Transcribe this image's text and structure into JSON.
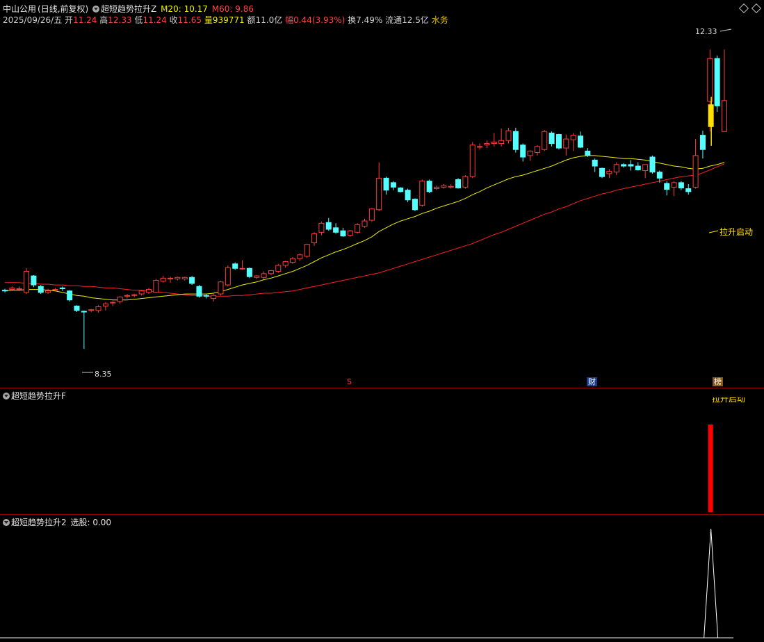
{
  "stock": {
    "name": "中山公用",
    "mode": "(日线,前复权)"
  },
  "main_indicator": {
    "name": "超短趋势拉升Z",
    "m20": "M20: 10.17",
    "m60": "M60: 9.86"
  },
  "info": {
    "date": "2025/09/26/五",
    "open_label": "开",
    "open": "11.24",
    "high_label": "高",
    "high": "12.33",
    "low_label": "低",
    "low": "11.24",
    "close_label": "收",
    "close": "11.65",
    "vol_label": "量",
    "vol": "939771",
    "amt_label": "额",
    "amt": "11.0亿",
    "chg_label": "幅",
    "chg": "0.44(3.93%)",
    "turn_label": "换",
    "turn": "7.49%",
    "float_label": "流通",
    "float": "12.5亿",
    "sector": "水务"
  },
  "annotations": {
    "max_price": "12.33",
    "min_price": "8.35",
    "signal": "拉升启动",
    "marker_s": "S",
    "marker_cai": "财",
    "marker_bang": "榜"
  },
  "sub1": {
    "name": "超短趋势拉升F",
    "label": "拉升启动"
  },
  "sub2": {
    "name": "超短趋势拉升2",
    "value": "选股: 0.00"
  },
  "colors": {
    "up": "#ff3c3c",
    "down": "#54ffff",
    "ma20": "#f0f000",
    "ma60": "#ff2020",
    "signal": "#ffe000"
  },
  "chart_data": {
    "type": "candlestick",
    "ylim": [
      8.0,
      12.6
    ],
    "candles": [
      [
        9.13,
        9.15,
        9.1,
        9.12
      ],
      [
        9.14,
        9.18,
        9.12,
        9.16
      ],
      [
        9.14,
        9.18,
        9.12,
        9.15
      ],
      [
        9.1,
        9.42,
        9.08,
        9.38
      ],
      [
        9.32,
        9.33,
        9.17,
        9.2
      ],
      [
        9.18,
        9.2,
        9.08,
        9.1
      ],
      [
        9.1,
        9.15,
        9.08,
        9.12
      ],
      [
        9.14,
        9.16,
        9.12,
        9.14
      ],
      [
        9.16,
        9.18,
        9.12,
        9.15
      ],
      [
        9.12,
        9.13,
        8.98,
        9.0
      ],
      [
        8.92,
        8.93,
        8.84,
        8.86
      ],
      [
        8.85,
        8.86,
        8.35,
        8.84
      ],
      [
        8.86,
        8.88,
        8.84,
        8.87
      ],
      [
        8.86,
        8.93,
        8.83,
        8.91
      ],
      [
        8.92,
        8.97,
        8.86,
        8.95
      ],
      [
        8.96,
        8.98,
        8.92,
        8.97
      ],
      [
        8.98,
        9.05,
        8.95,
        9.04
      ],
      [
        9.05,
        9.08,
        9.02,
        9.06
      ],
      [
        9.06,
        9.08,
        9.04,
        9.07
      ],
      [
        9.08,
        9.13,
        9.06,
        9.12
      ],
      [
        9.1,
        9.16,
        9.08,
        9.14
      ],
      [
        9.1,
        9.28,
        9.09,
        9.26
      ],
      [
        9.25,
        9.32,
        9.23,
        9.29
      ],
      [
        9.28,
        9.31,
        9.23,
        9.29
      ],
      [
        9.28,
        9.31,
        9.26,
        9.3
      ],
      [
        9.28,
        9.31,
        9.26,
        9.3
      ],
      [
        9.3,
        9.32,
        9.2,
        9.22
      ],
      [
        9.18,
        9.2,
        9.03,
        9.05
      ],
      [
        9.06,
        9.08,
        9.02,
        9.05
      ],
      [
        9.02,
        9.08,
        8.98,
        9.06
      ],
      [
        9.08,
        9.25,
        9.06,
        9.24
      ],
      [
        9.2,
        9.46,
        9.18,
        9.43
      ],
      [
        9.48,
        9.5,
        9.4,
        9.42
      ],
      [
        9.42,
        9.53,
        9.4,
        9.42
      ],
      [
        9.42,
        9.43,
        9.29,
        9.31
      ],
      [
        9.3,
        9.33,
        9.28,
        9.32
      ],
      [
        9.3,
        9.38,
        9.28,
        9.35
      ],
      [
        9.35,
        9.4,
        9.33,
        9.39
      ],
      [
        9.38,
        9.48,
        9.36,
        9.46
      ],
      [
        9.46,
        9.52,
        9.43,
        9.51
      ],
      [
        9.5,
        9.57,
        9.48,
        9.55
      ],
      [
        9.55,
        9.62,
        9.52,
        9.6
      ],
      [
        9.58,
        9.75,
        9.56,
        9.74
      ],
      [
        9.76,
        9.9,
        9.72,
        9.88
      ],
      [
        9.9,
        10.04,
        9.86,
        10.02
      ],
      [
        10.03,
        10.09,
        9.92,
        9.94
      ],
      [
        9.96,
        10.02,
        9.88,
        9.9
      ],
      [
        9.92,
        9.96,
        9.84,
        9.85
      ],
      [
        9.86,
        9.93,
        9.84,
        9.92
      ],
      [
        9.9,
        10.02,
        9.88,
        10.0
      ],
      [
        9.98,
        10.08,
        9.96,
        10.05
      ],
      [
        10.06,
        10.22,
        10.04,
        10.21
      ],
      [
        10.2,
        10.83,
        10.18,
        10.62
      ],
      [
        10.62,
        10.64,
        10.4,
        10.46
      ],
      [
        10.56,
        10.58,
        10.46,
        10.5
      ],
      [
        10.49,
        10.5,
        10.43,
        10.44
      ],
      [
        10.46,
        10.48,
        10.3,
        10.33
      ],
      [
        10.34,
        10.35,
        10.18,
        10.2
      ],
      [
        10.26,
        10.6,
        10.24,
        10.58
      ],
      [
        10.58,
        10.6,
        10.42,
        10.44
      ],
      [
        10.48,
        10.52,
        10.46,
        10.5
      ],
      [
        10.5,
        10.54,
        10.48,
        10.52
      ],
      [
        10.5,
        10.54,
        10.48,
        10.51
      ],
      [
        10.6,
        10.62,
        10.48,
        10.49
      ],
      [
        10.5,
        10.66,
        10.48,
        10.64
      ],
      [
        10.64,
        11.1,
        10.62,
        11.06
      ],
      [
        11.04,
        11.08,
        11.0,
        11.04
      ],
      [
        11.06,
        11.12,
        11.02,
        11.08
      ],
      [
        11.08,
        11.22,
        11.04,
        11.1
      ],
      [
        11.08,
        11.28,
        11.04,
        11.12
      ],
      [
        11.12,
        11.29,
        11.08,
        11.25
      ],
      [
        11.24,
        11.29,
        10.96,
        11.0
      ],
      [
        11.06,
        11.08,
        10.84,
        10.9
      ],
      [
        10.92,
        10.99,
        10.85,
        10.98
      ],
      [
        10.96,
        11.06,
        10.92,
        11.04
      ],
      [
        11.0,
        11.26,
        10.98,
        11.24
      ],
      [
        11.22,
        11.24,
        11.04,
        11.08
      ],
      [
        11.2,
        11.21,
        11.0,
        11.02
      ],
      [
        11.02,
        11.2,
        10.92,
        11.14
      ],
      [
        11.13,
        11.22,
        10.98,
        11.19
      ],
      [
        11.18,
        11.24,
        11.02,
        11.03
      ],
      [
        10.98,
        11.02,
        10.9,
        10.92
      ],
      [
        10.86,
        10.88,
        10.7,
        10.78
      ],
      [
        10.75,
        10.76,
        10.62,
        10.64
      ],
      [
        10.68,
        10.74,
        10.62,
        10.71
      ],
      [
        10.7,
        10.83,
        10.66,
        10.8
      ],
      [
        10.8,
        10.82,
        10.76,
        10.78
      ],
      [
        10.8,
        10.86,
        10.72,
        10.78
      ],
      [
        10.78,
        10.83,
        10.72,
        10.73
      ],
      [
        10.72,
        10.78,
        10.62,
        10.8
      ],
      [
        10.9,
        10.92,
        10.68,
        10.7
      ],
      [
        10.7,
        10.72,
        10.56,
        10.62
      ],
      [
        10.55,
        10.58,
        10.39,
        10.47
      ],
      [
        10.5,
        10.58,
        10.38,
        10.56
      ],
      [
        10.56,
        10.58,
        10.46,
        10.49
      ],
      [
        10.48,
        10.54,
        10.4,
        10.44
      ],
      [
        10.5,
        11.14,
        10.48,
        10.92
      ],
      [
        11.19,
        11.25,
        10.88,
        11.0
      ],
      [
        11.64,
        12.33,
        11.24,
        12.21
      ],
      [
        12.21,
        12.25,
        11.5,
        11.58
      ],
      [
        11.24,
        12.33,
        11.24,
        11.65
      ]
    ],
    "ma20": [
      9.12,
      9.13,
      9.13,
      9.14,
      9.14,
      9.14,
      9.13,
      9.12,
      9.1,
      9.08,
      9.06,
      9.05,
      9.03,
      9.02,
      9.01,
      9.0,
      9.0,
      9.0,
      9.01,
      9.02,
      9.03,
      9.04,
      9.05,
      9.06,
      9.07,
      9.08,
      9.08,
      9.08,
      9.08,
      9.09,
      9.11,
      9.14,
      9.17,
      9.2,
      9.22,
      9.24,
      9.27,
      9.29,
      9.32,
      9.35,
      9.38,
      9.42,
      9.46,
      9.51,
      9.56,
      9.6,
      9.64,
      9.67,
      9.71,
      9.75,
      9.79,
      9.84,
      9.91,
      9.96,
      10.01,
      10.05,
      10.08,
      10.11,
      10.15,
      10.18,
      10.22,
      10.25,
      10.28,
      10.31,
      10.35,
      10.4,
      10.44,
      10.49,
      10.53,
      10.57,
      10.61,
      10.64,
      10.66,
      10.69,
      10.72,
      10.75,
      10.78,
      10.82,
      10.86,
      10.89,
      10.91,
      10.92,
      10.92,
      10.91,
      10.9,
      10.89,
      10.88,
      10.88,
      10.87,
      10.86,
      10.84,
      10.82,
      10.8,
      10.78,
      10.77,
      10.75,
      10.74,
      10.75,
      10.78,
      10.8,
      10.83
    ],
    "ma60": [
      9.23,
      9.23,
      9.23,
      9.22,
      9.22,
      9.21,
      9.21,
      9.2,
      9.2,
      9.19,
      9.19,
      9.18,
      9.18,
      9.17,
      9.16,
      9.16,
      9.15,
      9.14,
      9.13,
      9.13,
      9.12,
      9.11,
      9.1,
      9.09,
      9.08,
      9.07,
      9.06,
      9.06,
      9.05,
      9.05,
      9.05,
      9.05,
      9.06,
      9.06,
      9.07,
      9.08,
      9.09,
      9.09,
      9.1,
      9.11,
      9.12,
      9.14,
      9.16,
      9.18,
      9.2,
      9.22,
      9.24,
      9.26,
      9.28,
      9.3,
      9.32,
      9.34,
      9.36,
      9.39,
      9.42,
      9.45,
      9.48,
      9.51,
      9.54,
      9.57,
      9.6,
      9.63,
      9.66,
      9.69,
      9.72,
      9.75,
      9.79,
      9.83,
      9.87,
      9.9,
      9.94,
      9.98,
      10.02,
      10.06,
      10.1,
      10.14,
      10.17,
      10.21,
      10.24,
      10.28,
      10.32,
      10.35,
      10.38,
      10.41,
      10.43,
      10.46,
      10.48,
      10.5,
      10.52,
      10.54,
      10.56,
      10.58,
      10.6,
      10.62,
      10.64,
      10.65,
      10.66,
      10.69,
      10.73,
      10.77,
      10.81
    ],
    "signal_bar": {
      "index": 99,
      "low": 11.05,
      "high": 11.7,
      "body_low": 11.3,
      "body_high": 11.6
    },
    "sub1_bar": {
      "index": 99,
      "value": 1
    },
    "sub2_spike": {
      "index": 99,
      "value": 1
    }
  }
}
